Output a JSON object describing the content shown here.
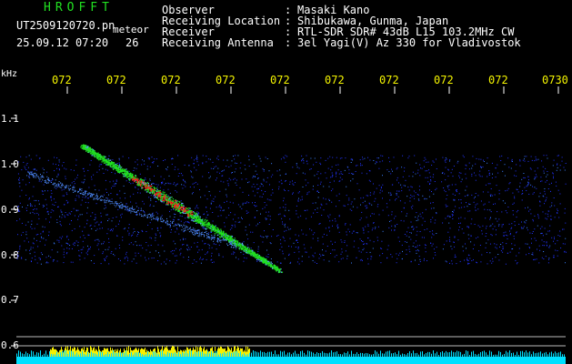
{
  "app": {
    "title": "HROFFT"
  },
  "header": {
    "fields": [
      {
        "label": "Observer",
        "value": "Masaki Kano"
      },
      {
        "label": "Receiving Location",
        "value": "Shibukawa, Gunma, Japan"
      },
      {
        "label": "Receiver",
        "value": "RTL-SDR SDR# 43dB L15 103.2MHz CW"
      },
      {
        "label": "Receiving Antenna",
        "value": "3el Yagi(V) Az 330 for Vladivostok"
      }
    ],
    "colon": ":"
  },
  "file": {
    "name": "UT2509120720.pn",
    "kind": "meteor",
    "datetime": "25.09.12 07:20",
    "count": "26"
  },
  "spectrogram": {
    "frequency_unit": "kHz",
    "time_ticks": [
      "072",
      "072",
      "072",
      "072",
      "072",
      "072",
      "072",
      "072",
      "072",
      "0730"
    ],
    "freq_ticks": [
      {
        "label": "1.1",
        "value": 1.1
      },
      {
        "label": "1.0",
        "value": 1.0
      },
      {
        "label": "0.9",
        "value": 0.9
      },
      {
        "label": "0.8",
        "value": 0.8
      },
      {
        "label": "0.7",
        "value": 0.7
      },
      {
        "label": "0.6",
        "value": 0.6
      }
    ],
    "colors": {
      "background": "#000000",
      "grid": "#ffffff",
      "tick_text": "#f4f400",
      "noise": "#2233ff",
      "meteor_hot": "#ff2020",
      "meteor_warm": "#20e020",
      "signal_bar": "#f8f000",
      "baseline": "#00e0ff"
    },
    "meteor_trail": {
      "start": {
        "time_fraction": 0.12,
        "freq_khz": 1.04
      },
      "end": {
        "time_fraction": 0.48,
        "freq_khz": 0.765
      }
    },
    "noise_gaps": [
      0.47,
      0.67,
      0.77
    ]
  }
}
